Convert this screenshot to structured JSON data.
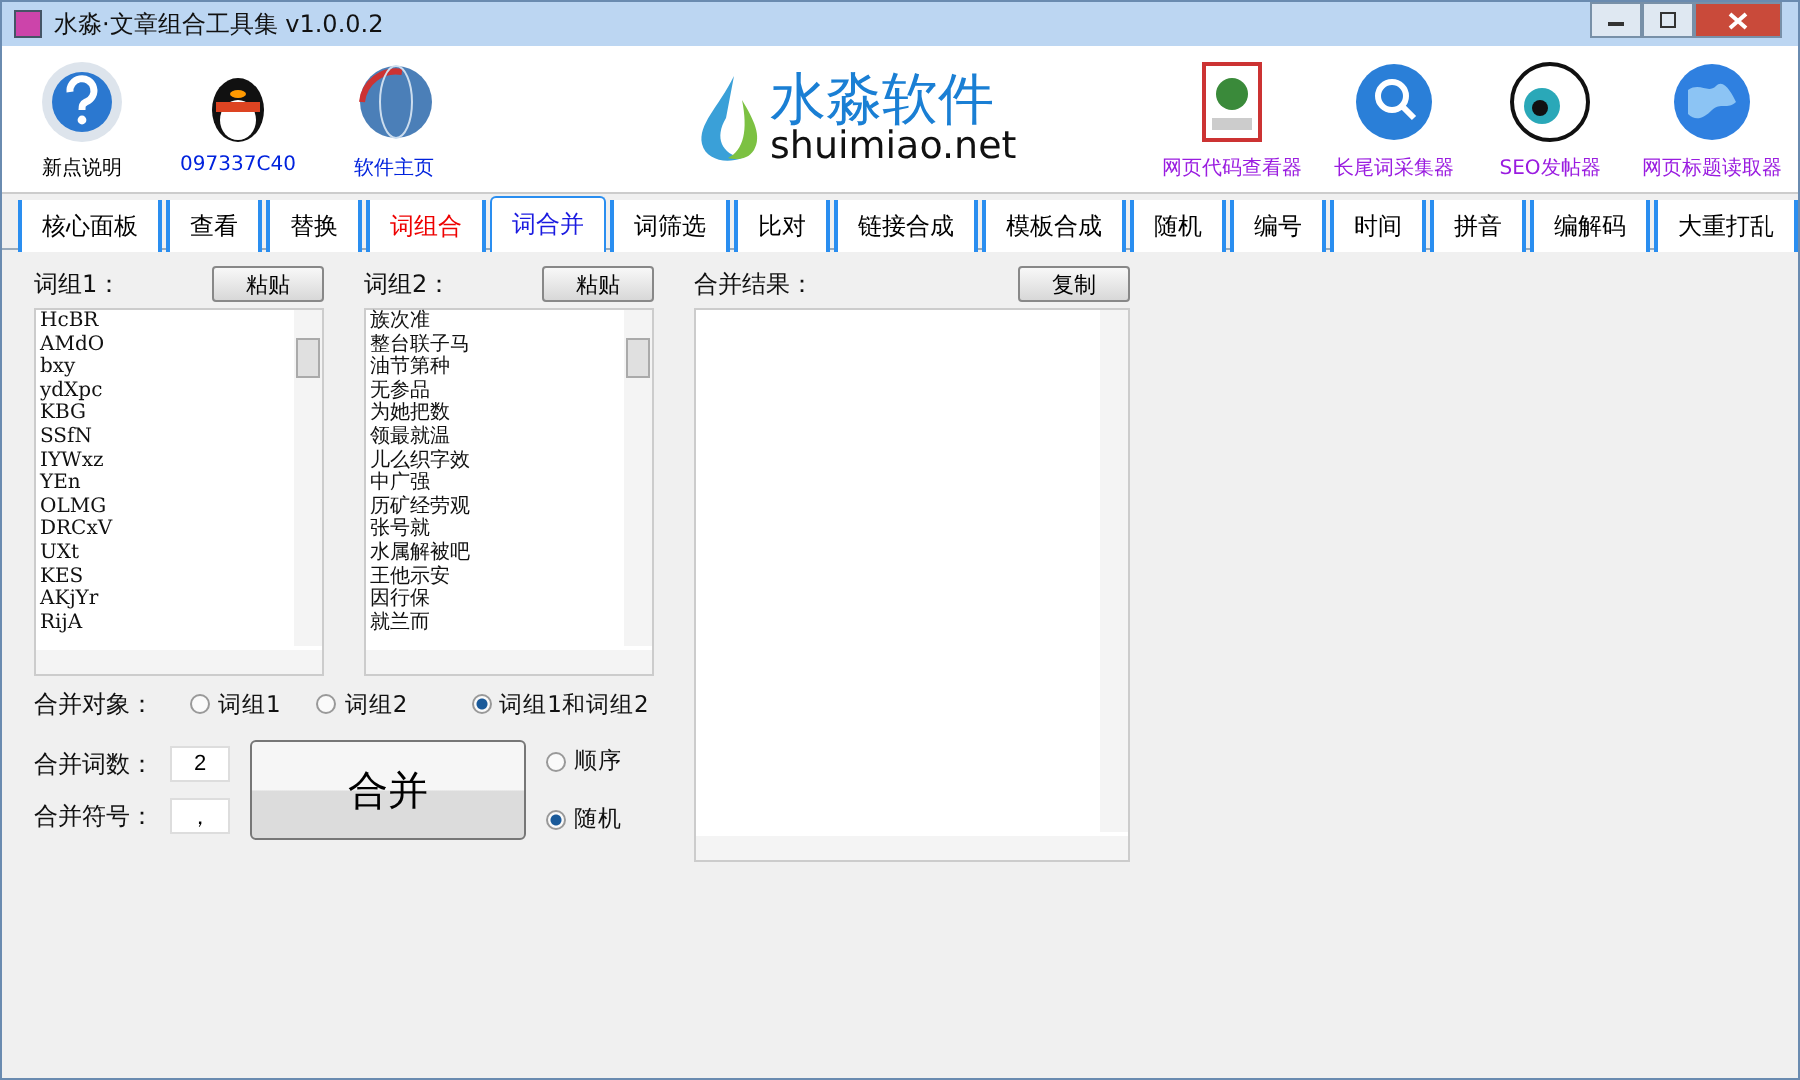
{
  "window": {
    "title": "水淼·文章组合工具集 v1.0.0.2"
  },
  "toolbar_left": [
    {
      "label": "新点说明",
      "kind": "help"
    },
    {
      "label": "097337C40",
      "kind": "penguin"
    },
    {
      "label": "软件主页",
      "kind": "globe"
    }
  ],
  "logo": {
    "name": "水淼软件",
    "domain": "shuimiao.net"
  },
  "toolbar_right": [
    {
      "label": "网页代码查看器",
      "kind": "html"
    },
    {
      "label": "长尾词采集器",
      "kind": "search"
    },
    {
      "label": "SEO发帖器",
      "kind": "eye"
    },
    {
      "label": "网页标题读取器",
      "kind": "earth"
    }
  ],
  "tabs": [
    {
      "label": "核心面板",
      "selected": false,
      "highlight": false
    },
    {
      "label": "查看",
      "selected": false,
      "highlight": false
    },
    {
      "label": "替换",
      "selected": false,
      "highlight": false
    },
    {
      "label": "词组合",
      "selected": false,
      "highlight": true
    },
    {
      "label": "词合并",
      "selected": true,
      "highlight": false
    },
    {
      "label": "词筛选",
      "selected": false,
      "highlight": false
    },
    {
      "label": "比对",
      "selected": false,
      "highlight": false
    },
    {
      "label": "链接合成",
      "selected": false,
      "highlight": false
    },
    {
      "label": "模板合成",
      "selected": false,
      "highlight": false
    },
    {
      "label": "随机",
      "selected": false,
      "highlight": false
    },
    {
      "label": "编号",
      "selected": false,
      "highlight": false
    },
    {
      "label": "时间",
      "selected": false,
      "highlight": false
    },
    {
      "label": "拼音",
      "selected": false,
      "highlight": false
    },
    {
      "label": "编解码",
      "selected": false,
      "highlight": false
    },
    {
      "label": "大重打乱",
      "selected": false,
      "highlight": false
    }
  ],
  "group1": {
    "label": "词组1：",
    "button": "粘贴",
    "items": [
      "HcBR",
      "AMdO",
      "bxy",
      "ydXpc",
      "KBG",
      "SSfN",
      "IYWxz",
      "YEn",
      "OLMG",
      "DRCxV",
      "UXt",
      "KES",
      "AKjYr",
      "RijA"
    ]
  },
  "group2": {
    "label": "词组2：",
    "button": "粘贴",
    "items": [
      "族次准",
      "整台联子马",
      "油节第种",
      "无参品",
      "为她把数",
      "领最就温",
      "儿么织字效",
      "中广强",
      "历矿经劳观",
      "张号就",
      "水属解被吧",
      "王他示安",
      "因行保",
      "就兰而"
    ]
  },
  "result": {
    "label": "合并结果：",
    "button": "复制"
  },
  "target": {
    "label": "合并对象：",
    "options": [
      {
        "label": "词组1",
        "selected": false
      },
      {
        "label": "词组2",
        "selected": false
      },
      {
        "label": "词组1和词组2",
        "selected": true
      }
    ]
  },
  "count": {
    "label": "合并词数：",
    "value": "2"
  },
  "separator": {
    "label": "合并符号：",
    "value": "，"
  },
  "merge_button": "合并",
  "order": [
    {
      "label": "顺序",
      "selected": false
    },
    {
      "label": "随机",
      "selected": true
    }
  ]
}
